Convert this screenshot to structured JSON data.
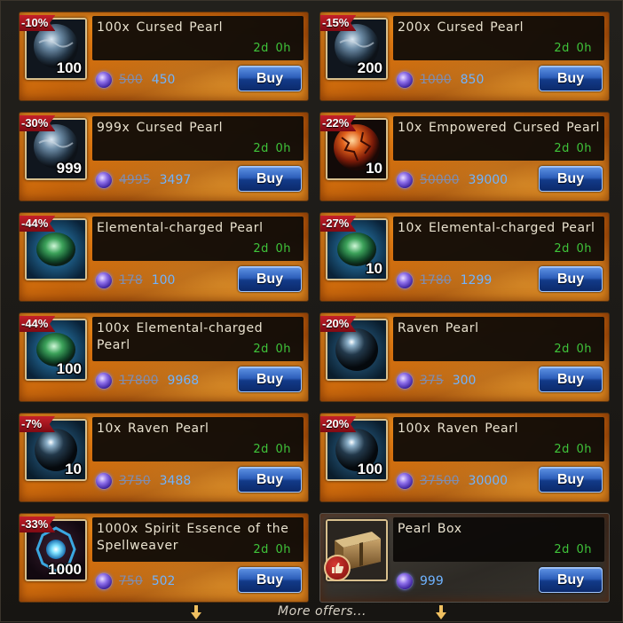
{
  "colors": {
    "card_orange": "#e07a12",
    "discount_red": "#b01a22",
    "time_green": "#3fc43a",
    "price_blue": "#6fb3ff",
    "buy_blue": "#2d5fba"
  },
  "offers": [
    {
      "name": "100x  Cursed  Pearl",
      "quantity": "100",
      "discount": "-10%",
      "time": "2d  0h",
      "old_price": "500",
      "price": "450",
      "buy_label": "Buy",
      "icon": "cursed-pearl-icon"
    },
    {
      "name": "200x  Cursed  Pearl",
      "quantity": "200",
      "discount": "-15%",
      "time": "2d  0h",
      "old_price": "1000",
      "price": "850",
      "buy_label": "Buy",
      "icon": "cursed-pearl-icon"
    },
    {
      "name": "999x  Cursed  Pearl",
      "quantity": "999",
      "discount": "-30%",
      "time": "2d  0h",
      "old_price": "4995",
      "price": "3497",
      "buy_label": "Buy",
      "icon": "cursed-pearl-icon"
    },
    {
      "name": "10x  Empowered  Cursed  Pearl",
      "quantity": "10",
      "discount": "-22%",
      "time": "2d  0h",
      "old_price": "50000",
      "price": "39000",
      "buy_label": "Buy",
      "icon": "empowered-cursed-pearl-icon"
    },
    {
      "name": "Elemental-charged  Pearl",
      "quantity": "",
      "discount": "-44%",
      "time": "2d  0h",
      "old_price": "178",
      "price": "100",
      "buy_label": "Buy",
      "icon": "elemental-pearl-icon"
    },
    {
      "name": "10x  Elemental-charged  Pearl",
      "quantity": "10",
      "discount": "-27%",
      "time": "2d  0h",
      "old_price": "1780",
      "price": "1299",
      "buy_label": "Buy",
      "icon": "elemental-pearl-icon"
    },
    {
      "name": "100x  Elemental-charged  Pearl",
      "quantity": "100",
      "discount": "-44%",
      "time": "2d  0h",
      "old_price": "17800",
      "price": "9968",
      "buy_label": "Buy",
      "icon": "elemental-pearl-icon"
    },
    {
      "name": "Raven  Pearl",
      "quantity": "",
      "discount": "-20%",
      "time": "2d  0h",
      "old_price": "375",
      "price": "300",
      "buy_label": "Buy",
      "icon": "raven-pearl-icon"
    },
    {
      "name": "10x  Raven  Pearl",
      "quantity": "10",
      "discount": "-7%",
      "time": "2d  0h",
      "old_price": "3750",
      "price": "3488",
      "buy_label": "Buy",
      "icon": "raven-pearl-icon"
    },
    {
      "name": "100x  Raven  Pearl",
      "quantity": "100",
      "discount": "-20%",
      "time": "2d  0h",
      "old_price": "37500",
      "price": "30000",
      "buy_label": "Buy",
      "icon": "raven-pearl-icon"
    },
    {
      "name": "1000x  Spirit  Essence  of  the  Spellweaver",
      "quantity": "1000",
      "discount": "-33%",
      "time": "2d  0h",
      "old_price": "750",
      "price": "502",
      "buy_label": "Buy",
      "icon": "spirit-essence-icon"
    },
    {
      "name": "Pearl  Box",
      "quantity": "",
      "discount": "",
      "time": "2d  0h",
      "old_price": "",
      "price": "999",
      "buy_label": "Buy",
      "icon": "pearl-box-icon",
      "recommended": true
    }
  ],
  "footer": {
    "more_offers": "More offers..."
  }
}
